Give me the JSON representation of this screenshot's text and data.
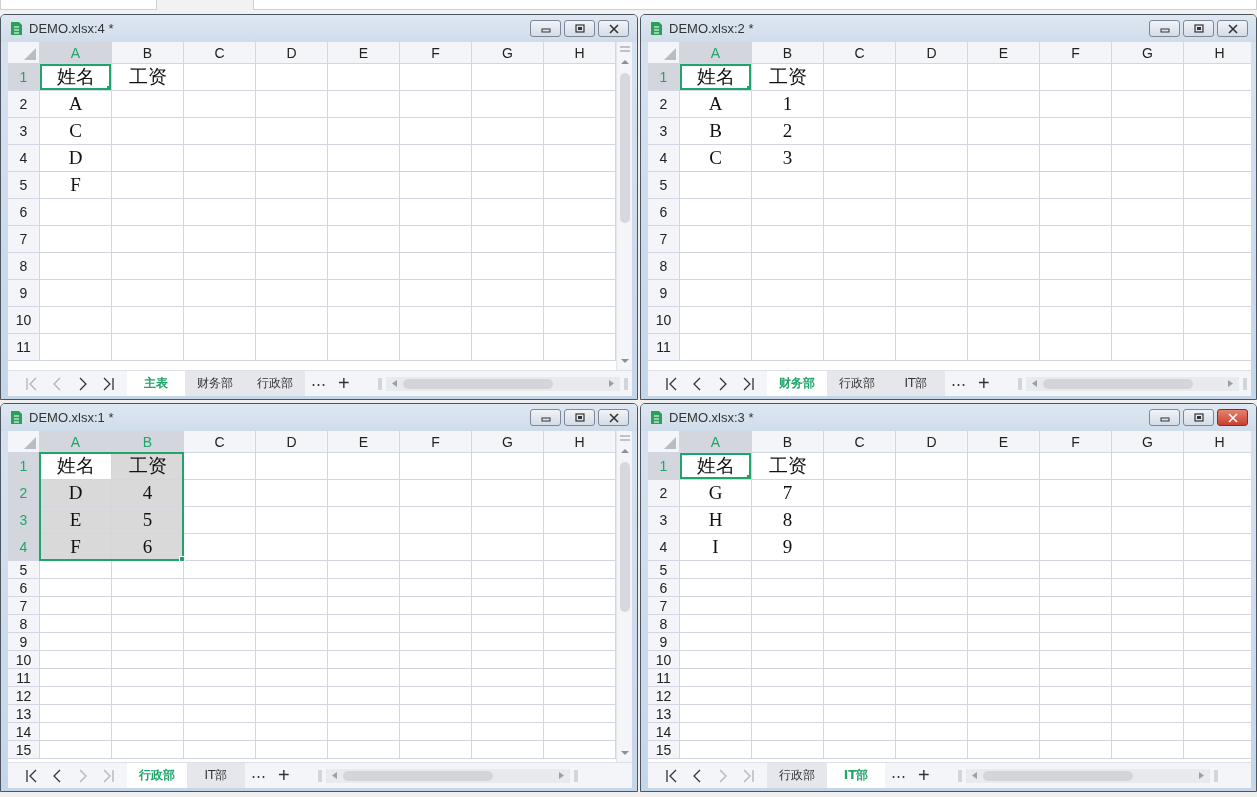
{
  "windows": [
    {
      "title": "DEMO.xlsx:4 *",
      "active": false,
      "vertical_scrollbar": true,
      "columns": [
        {
          "label": "A",
          "selected": true
        },
        {
          "label": "B",
          "selected": false
        },
        {
          "label": "C",
          "selected": false
        },
        {
          "label": "D",
          "selected": false
        },
        {
          "label": "E",
          "selected": false
        },
        {
          "label": "F",
          "selected": false
        },
        {
          "label": "G",
          "selected": false
        },
        {
          "label": "H",
          "selected": false
        }
      ],
      "rows": [
        {
          "label": "1",
          "kind": "tall",
          "selected": true,
          "cells": [
            {
              "text": "姓名",
              "selected": true,
              "active": true
            },
            {
              "text": "工资",
              "selected": false,
              "active": false
            }
          ]
        },
        {
          "label": "2",
          "kind": "tall",
          "selected": false,
          "cells": [
            {
              "text": "A",
              "selected": false,
              "active": false
            }
          ]
        },
        {
          "label": "3",
          "kind": "tall",
          "selected": false,
          "cells": [
            {
              "text": "C",
              "selected": false,
              "active": false
            }
          ]
        },
        {
          "label": "4",
          "kind": "tall",
          "selected": false,
          "cells": [
            {
              "text": "D",
              "selected": false,
              "active": false
            }
          ]
        },
        {
          "label": "5",
          "kind": "tall",
          "selected": false,
          "cells": [
            {
              "text": "F",
              "selected": false,
              "active": false
            }
          ]
        },
        {
          "label": "6",
          "kind": "tall",
          "selected": false
        },
        {
          "label": "7",
          "kind": "tall",
          "selected": false
        },
        {
          "label": "8",
          "kind": "tall",
          "selected": false
        },
        {
          "label": "9",
          "kind": "tall",
          "selected": false
        },
        {
          "label": "10",
          "kind": "tall",
          "selected": false
        },
        {
          "label": "11",
          "kind": "tall",
          "selected": false
        }
      ],
      "nav": [
        {
          "kind": "first",
          "disabled": true
        },
        {
          "kind": "prev",
          "disabled": true
        },
        {
          "kind": "next",
          "disabled": false
        },
        {
          "kind": "last",
          "disabled": false
        }
      ],
      "tabs": [
        {
          "label": "主表",
          "selected": true
        },
        {
          "label": "财务部",
          "selected": false
        },
        {
          "label": "行政部",
          "selected": false
        }
      ],
      "more": "⋯",
      "add": "+"
    },
    {
      "title": "DEMO.xlsx:2 *",
      "active": false,
      "vertical_scrollbar": false,
      "columns": [
        {
          "label": "A",
          "selected": true
        },
        {
          "label": "B",
          "selected": false
        },
        {
          "label": "C",
          "selected": false
        },
        {
          "label": "D",
          "selected": false
        },
        {
          "label": "E",
          "selected": false
        },
        {
          "label": "F",
          "selected": false
        },
        {
          "label": "G",
          "selected": false
        },
        {
          "label": "H",
          "selected": false
        }
      ],
      "rows": [
        {
          "label": "1",
          "kind": "tall",
          "selected": true,
          "cells": [
            {
              "text": "姓名",
              "selected": true,
              "active": true
            },
            {
              "text": "工资",
              "selected": false,
              "active": false
            }
          ]
        },
        {
          "label": "2",
          "kind": "tall",
          "selected": false,
          "cells": [
            {
              "text": "A",
              "selected": false,
              "active": false
            },
            {
              "text": "1",
              "selected": false,
              "active": false
            }
          ]
        },
        {
          "label": "3",
          "kind": "tall",
          "selected": false,
          "cells": [
            {
              "text": "B",
              "selected": false,
              "active": false
            },
            {
              "text": "2",
              "selected": false,
              "active": false
            }
          ]
        },
        {
          "label": "4",
          "kind": "tall",
          "selected": false,
          "cells": [
            {
              "text": "C",
              "selected": false,
              "active": false
            },
            {
              "text": "3",
              "selected": false,
              "active": false
            }
          ]
        },
        {
          "label": "5",
          "kind": "tall",
          "selected": false
        },
        {
          "label": "6",
          "kind": "tall",
          "selected": false
        },
        {
          "label": "7",
          "kind": "tall",
          "selected": false
        },
        {
          "label": "8",
          "kind": "tall",
          "selected": false
        },
        {
          "label": "9",
          "kind": "tall",
          "selected": false
        },
        {
          "label": "10",
          "kind": "tall",
          "selected": false
        },
        {
          "label": "11",
          "kind": "tall",
          "selected": false
        }
      ],
      "nav": [
        {
          "kind": "first",
          "disabled": false
        },
        {
          "kind": "prev",
          "disabled": false
        },
        {
          "kind": "next",
          "disabled": false
        },
        {
          "kind": "last",
          "disabled": false
        }
      ],
      "tabs": [
        {
          "label": "财务部",
          "selected": true
        },
        {
          "label": "行政部",
          "selected": false
        },
        {
          "label": "IT部",
          "selected": false
        }
      ],
      "more": "⋯",
      "add": "+"
    },
    {
      "title": "DEMO.xlsx:1 *",
      "active": false,
      "vertical_scrollbar": true,
      "columns": [
        {
          "label": "A",
          "selected": true
        },
        {
          "label": "B",
          "selected": true
        },
        {
          "label": "C",
          "selected": false
        },
        {
          "label": "D",
          "selected": false
        },
        {
          "label": "E",
          "selected": false
        },
        {
          "label": "F",
          "selected": false
        },
        {
          "label": "G",
          "selected": false
        },
        {
          "label": "H",
          "selected": false
        }
      ],
      "rows": [
        {
          "label": "1",
          "kind": "tall",
          "selected": true,
          "cells": [
            {
              "text": "姓名",
              "selected": true,
              "active": true
            },
            {
              "text": "工资",
              "selected": true,
              "active": false
            }
          ]
        },
        {
          "label": "2",
          "kind": "tall",
          "selected": true,
          "cells": [
            {
              "text": "D",
              "selected": true,
              "active": false
            },
            {
              "text": "4",
              "selected": true,
              "active": false
            }
          ]
        },
        {
          "label": "3",
          "kind": "tall",
          "selected": true,
          "cells": [
            {
              "text": "E",
              "selected": true,
              "active": false
            },
            {
              "text": "5",
              "selected": true,
              "active": false
            }
          ]
        },
        {
          "label": "4",
          "kind": "tall",
          "selected": true,
          "cells": [
            {
              "text": "F",
              "selected": true,
              "active": false
            },
            {
              "text": "6",
              "selected": true,
              "active": false
            }
          ]
        },
        {
          "label": "5",
          "kind": "short",
          "selected": false
        },
        {
          "label": "6",
          "kind": "short",
          "selected": false
        },
        {
          "label": "7",
          "kind": "short",
          "selected": false
        },
        {
          "label": "8",
          "kind": "short",
          "selected": false
        },
        {
          "label": "9",
          "kind": "short",
          "selected": false
        },
        {
          "label": "10",
          "kind": "short",
          "selected": false
        },
        {
          "label": "11",
          "kind": "short",
          "selected": false
        },
        {
          "label": "12",
          "kind": "short",
          "selected": false
        },
        {
          "label": "13",
          "kind": "short",
          "selected": false
        },
        {
          "label": "14",
          "kind": "short",
          "selected": false
        },
        {
          "label": "15",
          "kind": "short",
          "selected": false
        }
      ],
      "nav": [
        {
          "kind": "first",
          "disabled": false
        },
        {
          "kind": "prev",
          "disabled": false
        },
        {
          "kind": "next",
          "disabled": true
        },
        {
          "kind": "last",
          "disabled": true
        }
      ],
      "tabs": [
        {
          "label": "行政部",
          "selected": true
        },
        {
          "label": "IT部",
          "selected": false
        }
      ],
      "more": "⋯",
      "add": "+"
    },
    {
      "title": "DEMO.xlsx:3 *",
      "active": true,
      "vertical_scrollbar": false,
      "columns": [
        {
          "label": "A",
          "selected": true
        },
        {
          "label": "B",
          "selected": false
        },
        {
          "label": "C",
          "selected": false
        },
        {
          "label": "D",
          "selected": false
        },
        {
          "label": "E",
          "selected": false
        },
        {
          "label": "F",
          "selected": false
        },
        {
          "label": "G",
          "selected": false
        },
        {
          "label": "H",
          "selected": false
        }
      ],
      "rows": [
        {
          "label": "1",
          "kind": "tall",
          "selected": true,
          "cells": [
            {
              "text": "姓名",
              "selected": true,
              "active": true
            },
            {
              "text": "工资",
              "selected": false,
              "active": false
            }
          ]
        },
        {
          "label": "2",
          "kind": "tall",
          "selected": false,
          "cells": [
            {
              "text": "G",
              "selected": false,
              "active": false
            },
            {
              "text": "7",
              "selected": false,
              "active": false
            }
          ]
        },
        {
          "label": "3",
          "kind": "tall",
          "selected": false,
          "cells": [
            {
              "text": "H",
              "selected": false,
              "active": false
            },
            {
              "text": "8",
              "selected": false,
              "active": false
            }
          ]
        },
        {
          "label": "4",
          "kind": "tall",
          "selected": false,
          "cells": [
            {
              "text": "I",
              "selected": false,
              "active": false
            },
            {
              "text": "9",
              "selected": false,
              "active": false
            }
          ]
        },
        {
          "label": "5",
          "kind": "short",
          "selected": false
        },
        {
          "label": "6",
          "kind": "short",
          "selected": false
        },
        {
          "label": "7",
          "kind": "short",
          "selected": false
        },
        {
          "label": "8",
          "kind": "short",
          "selected": false
        },
        {
          "label": "9",
          "kind": "short",
          "selected": false
        },
        {
          "label": "10",
          "kind": "short",
          "selected": false
        },
        {
          "label": "11",
          "kind": "short",
          "selected": false
        },
        {
          "label": "12",
          "kind": "short",
          "selected": false
        },
        {
          "label": "13",
          "kind": "short",
          "selected": false
        },
        {
          "label": "14",
          "kind": "short",
          "selected": false
        },
        {
          "label": "15",
          "kind": "short",
          "selected": false
        }
      ],
      "nav": [
        {
          "kind": "first",
          "disabled": false
        },
        {
          "kind": "prev",
          "disabled": false
        },
        {
          "kind": "next",
          "disabled": true
        },
        {
          "kind": "last",
          "disabled": true
        }
      ],
      "tabs": [
        {
          "label": "行政部",
          "selected": false
        },
        {
          "label": "IT部",
          "selected": true
        }
      ],
      "more": "⋯",
      "add": "+"
    }
  ]
}
